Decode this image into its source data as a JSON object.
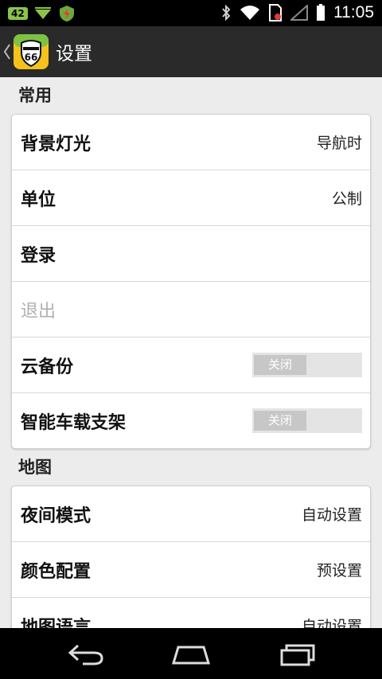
{
  "status_bar": {
    "notification_count": "42",
    "time": "11:05"
  },
  "action_bar": {
    "title": "设置",
    "app_icon_text": "ROUTE 66"
  },
  "sections": [
    {
      "title": "常用",
      "rows": [
        {
          "label": "背景灯光",
          "value": "导航时"
        },
        {
          "label": "单位",
          "value": "公制"
        },
        {
          "label": "登录",
          "value": ""
        },
        {
          "label": "退出",
          "value": "",
          "disabled": true
        },
        {
          "label": "云备份",
          "toggle": "关闭"
        },
        {
          "label": "智能车载支架",
          "toggle": "关闭"
        }
      ]
    },
    {
      "title": "地图",
      "rows": [
        {
          "label": "夜间模式",
          "value": "自动设置"
        },
        {
          "label": "颜色配置",
          "value": "预设置"
        },
        {
          "label": "地图语言",
          "value": "自动设置"
        }
      ]
    }
  ],
  "colors": {
    "background": "#ececec",
    "action_bar": "#2a2a2a",
    "toggle_off": "#c7c7c7"
  }
}
